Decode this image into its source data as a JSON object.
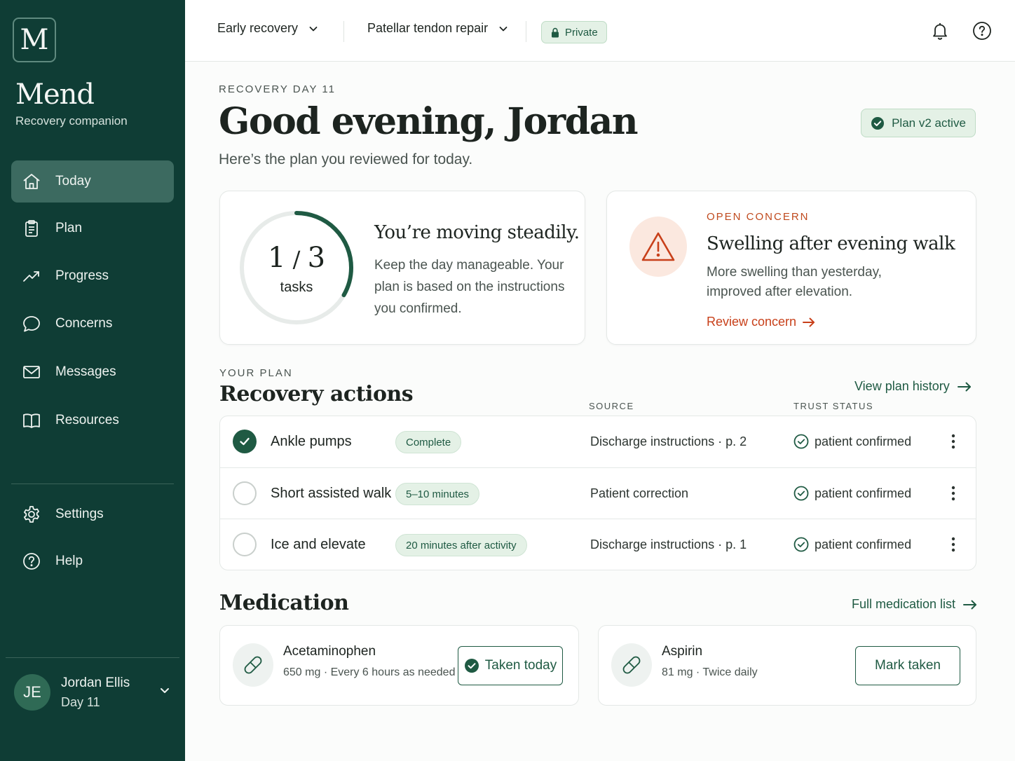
{
  "app": {
    "logo_letter": "M",
    "name": "Mend",
    "subtitle": "Recovery companion"
  },
  "nav": {
    "items": [
      {
        "label": "Today",
        "icon": "home-icon",
        "active": true
      },
      {
        "label": "Plan",
        "icon": "clipboard-icon"
      },
      {
        "label": "Progress",
        "icon": "trend-up-icon"
      },
      {
        "label": "Concerns",
        "icon": "chat-bubble-icon"
      },
      {
        "label": "Messages",
        "icon": "mail-icon"
      },
      {
        "label": "Resources",
        "icon": "book-icon"
      }
    ],
    "secondary": [
      {
        "label": "Settings",
        "icon": "gear-icon"
      },
      {
        "label": "Help",
        "icon": "help-circle-icon"
      }
    ]
  },
  "user": {
    "initials": "JE",
    "name": "Jordan Ellis",
    "day": "Day 11"
  },
  "topbar": {
    "phase": "Early recovery",
    "procedure": "Patellar tendon repair",
    "privacy": "Private"
  },
  "header": {
    "eyebrow": "RECOVERY DAY 11",
    "greeting": "Good evening, Jordan",
    "subtitle": "Here’s the plan you reviewed for today.",
    "plan_badge": "Plan v2 active"
  },
  "progress": {
    "done": "1",
    "total": "3",
    "label": "tasks",
    "title": "You’re moving steadily.",
    "description": "Keep the day manageable. Your plan is based on the instructions you confirmed."
  },
  "concern": {
    "eyebrow": "OPEN CONCERN",
    "title": "Swelling after evening walk",
    "description": "More swelling than yesterday, improved after elevation.",
    "link": "Review concern"
  },
  "plan": {
    "eyebrow": "YOUR PLAN",
    "title": "Recovery actions",
    "history_link": "View plan history",
    "columns": {
      "source": "SOURCE",
      "trust": "TRUST STATUS"
    },
    "rows": [
      {
        "name": "Ankle pumps",
        "tag": "Complete",
        "source": "Discharge instructions · p. 2",
        "trust": "patient confirmed",
        "done": true
      },
      {
        "name": "Short assisted walk",
        "tag": "5–10 minutes",
        "source": "Patient correction",
        "trust": "patient confirmed",
        "done": false
      },
      {
        "name": "Ice and elevate",
        "tag": "20 minutes after activity",
        "source": "Discharge instructions · p. 1",
        "trust": "patient confirmed",
        "done": false
      }
    ]
  },
  "medication": {
    "title": "Medication",
    "list_link": "Full medication list",
    "items": [
      {
        "name": "Acetaminophen",
        "info": "650 mg  ·  Every 6 hours as needed",
        "action": "Taken today"
      },
      {
        "name": "Aspirin",
        "info": "81 mg  ·  Twice daily",
        "action": "Mark taken"
      }
    ]
  },
  "colors": {
    "sidebar": "#0f3d35",
    "accent": "#1f5a43",
    "alert": "#c8401a",
    "badge_bg": "#e4f1e6"
  }
}
